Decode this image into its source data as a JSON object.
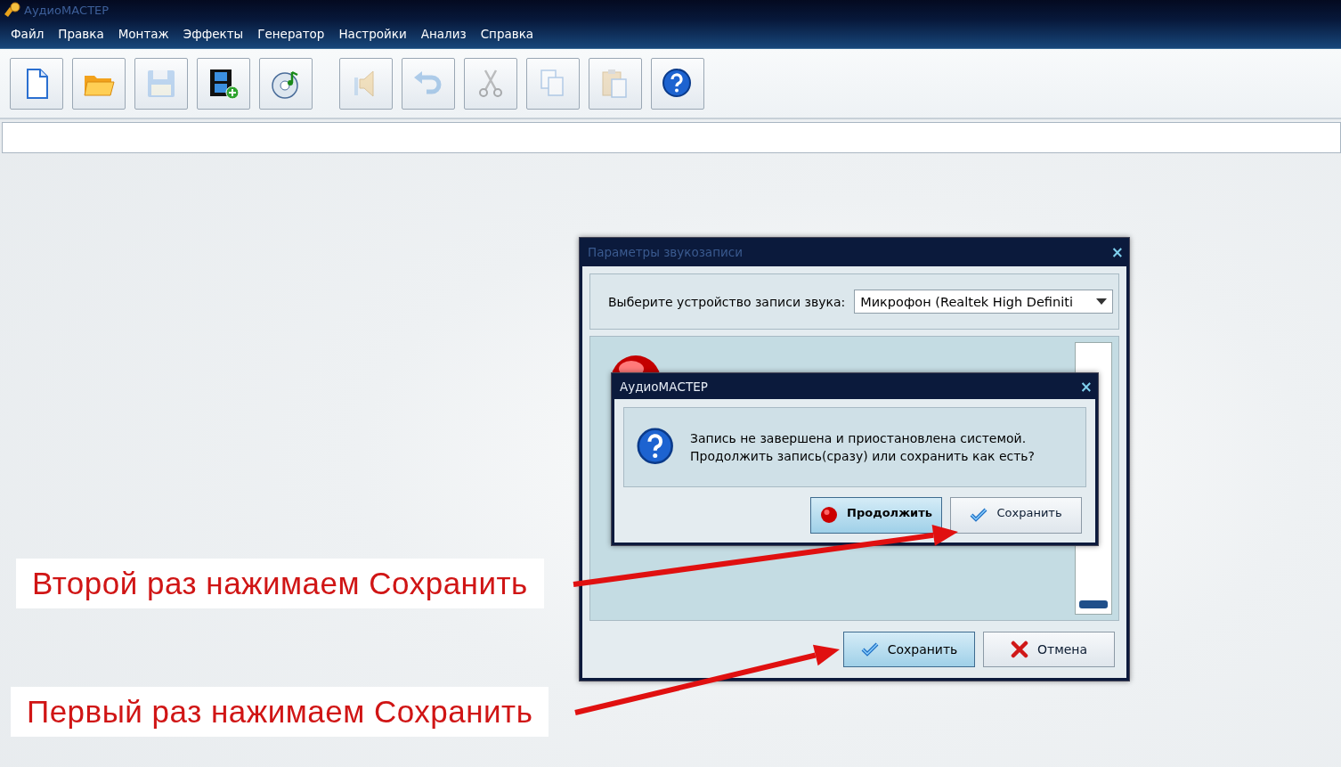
{
  "window": {
    "title": "АудиоМАСТЕР"
  },
  "menu": [
    "Файл",
    "Правка",
    "Монтаж",
    "Эффекты",
    "Генератор",
    "Настройки",
    "Анализ",
    "Справка"
  ],
  "toolbar": [
    {
      "kind": "new",
      "disabled": false
    },
    {
      "kind": "open",
      "disabled": false
    },
    {
      "kind": "save",
      "disabled": true
    },
    {
      "kind": "video",
      "disabled": false
    },
    {
      "kind": "disc",
      "disabled": false
    },
    {
      "kind": "speaker",
      "disabled": true
    },
    {
      "kind": "undo",
      "disabled": true
    },
    {
      "kind": "cut",
      "disabled": true
    },
    {
      "kind": "copy",
      "disabled": true
    },
    {
      "kind": "paste",
      "disabled": true
    },
    {
      "kind": "help",
      "disabled": false
    }
  ],
  "record_dialog": {
    "title": "Параметры звукозаписи",
    "close": "×",
    "device_label": "Выберите устройство записи звука:",
    "device_value": "Микрофон (Realtek High Definiti",
    "meter": {
      "level": 0.03
    },
    "buttons": [
      {
        "kind": "save",
        "label": "Сохранить",
        "default": true
      },
      {
        "kind": "cancel",
        "label": "Отмена",
        "default": false
      }
    ]
  },
  "message_dialog": {
    "title": "АудиоМАСТЕР",
    "close": "×",
    "message": "Запись не завершена и приостановлена системой.\nПродолжить запись(сразу) или сохранить как есть?",
    "buttons": [
      {
        "kind": "record",
        "label": "Продолжить",
        "default": true
      },
      {
        "kind": "save",
        "label": "Сохранить",
        "default": false
      }
    ]
  },
  "annotations": [
    {
      "text": "Второй раз нажимаем Сохранить"
    },
    {
      "text": "Первый раз нажимаем Сохранить"
    }
  ]
}
